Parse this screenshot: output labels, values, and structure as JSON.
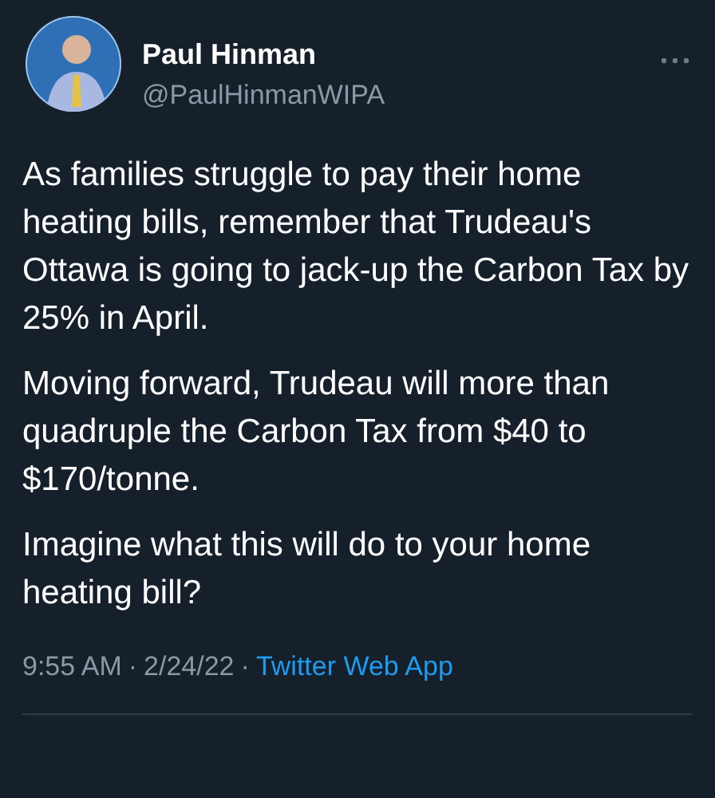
{
  "author": {
    "name": "Paul Hinman",
    "handle": "@PaulHinmanWIPA"
  },
  "paragraphs": [
    "As families struggle to pay their home heating bills, remember that Trudeau's Ottawa is going to jack-up the Carbon Tax by 25% in April.",
    "Moving forward, Trudeau will more than quadruple the Carbon Tax from $40 to $170/tonne.",
    "Imagine what this will do to your home heating bill?"
  ],
  "footer": {
    "time": "9:55 AM",
    "separator": "·",
    "date": "2/24/22",
    "source": "Twitter Web App"
  }
}
